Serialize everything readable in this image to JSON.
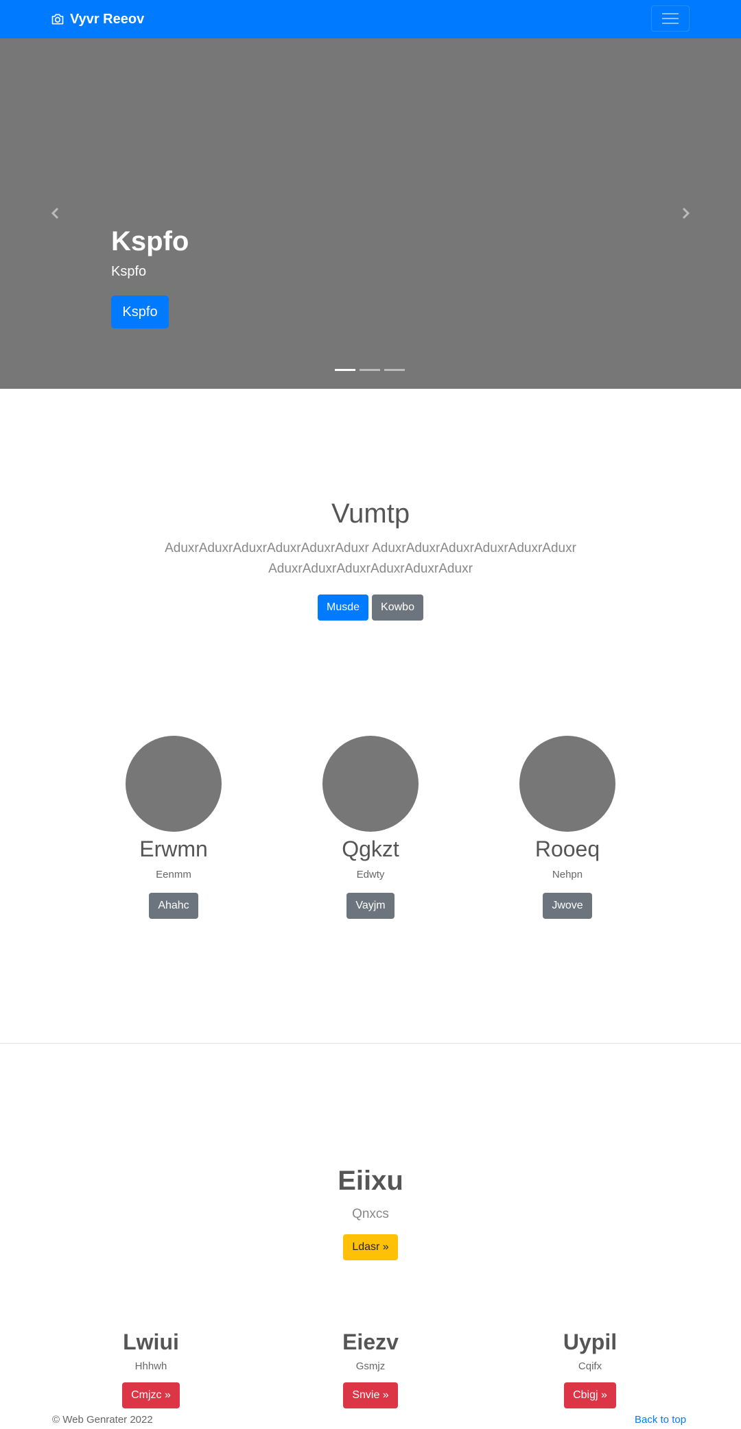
{
  "navbar": {
    "brand": "Vyvr Reeov",
    "brand_icon": "camera-icon",
    "toggler_icon": "hamburger-icon",
    "color": "#007bff"
  },
  "carousel": {
    "title": "Kspfo",
    "text": "Kspfo",
    "button": "Kspfo",
    "slide_count": 3,
    "active_slide": 0,
    "prev_icon": "chevron-left-icon",
    "next_icon": "chevron-right-icon"
  },
  "jumbotron": {
    "title": "Vumtp",
    "lead": "AduxrAduxrAduxrAduxrAduxrAduxr AduxrAduxrAduxrAduxrAduxrAduxr AduxrAduxrAduxrAduxrAduxrAduxr",
    "primary_button": "Musde",
    "secondary_button": "Kowbo"
  },
  "people": [
    {
      "name": "Erwmn",
      "sub": "Eenmm",
      "button": "Ahahc"
    },
    {
      "name": "Qgkzt",
      "sub": "Edwty",
      "button": "Vayjm"
    },
    {
      "name": "Rooeq",
      "sub": "Nehpn",
      "button": "Jwove"
    }
  ],
  "hero2": {
    "title": "Eiixu",
    "subtitle": "Qnxcs",
    "button": "Ldasr »"
  },
  "features": [
    {
      "title": "Lwiui",
      "sub": "Hhhwh",
      "button": "Cmjzc »"
    },
    {
      "title": "Eiezv",
      "sub": "Gsmjz",
      "button": "Snvie »"
    },
    {
      "title": "Uypil",
      "sub": "Cqifx",
      "button": "Cbigj »"
    }
  ],
  "footer": {
    "copyright": "© Web Genrater 2022",
    "back_to_top": "Back to top"
  }
}
